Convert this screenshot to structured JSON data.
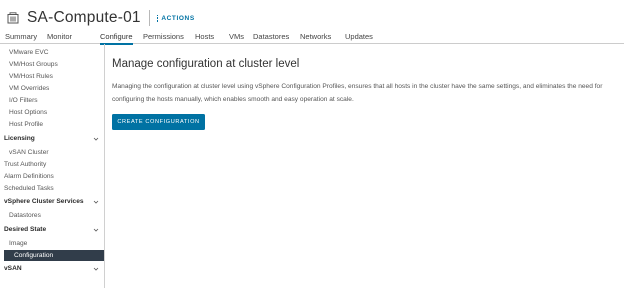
{
  "header": {
    "title": "SA-Compute-01",
    "title_icon": "cluster-icon",
    "actions_label": "ACTIONS"
  },
  "tabs": [
    {
      "label": "Summary",
      "active": false
    },
    {
      "label": "Monitor",
      "active": false
    },
    {
      "label": "Configure",
      "active": true
    },
    {
      "label": "Permissions",
      "active": false
    },
    {
      "label": "Hosts",
      "active": false
    },
    {
      "label": "VMs",
      "active": false
    },
    {
      "label": "Datastores",
      "active": false
    },
    {
      "label": "Networks",
      "active": false
    },
    {
      "label": "Updates",
      "active": false
    }
  ],
  "sidebar": {
    "items": [
      {
        "label": "VMware EVC",
        "kind": "sub"
      },
      {
        "label": "VM/Host Groups",
        "kind": "sub"
      },
      {
        "label": "VM/Host Rules",
        "kind": "sub"
      },
      {
        "label": "VM Overrides",
        "kind": "sub"
      },
      {
        "label": "I/O Filters",
        "kind": "sub"
      },
      {
        "label": "Host Options",
        "kind": "sub"
      },
      {
        "label": "Host Profile",
        "kind": "sub"
      },
      {
        "label": "Licensing",
        "kind": "group",
        "expanded": true
      },
      {
        "label": "vSAN Cluster",
        "kind": "sub"
      },
      {
        "label": "Trust Authority",
        "kind": "top"
      },
      {
        "label": "Alarm Definitions",
        "kind": "top"
      },
      {
        "label": "Scheduled Tasks",
        "kind": "top"
      },
      {
        "label": "vSphere Cluster Services",
        "kind": "group",
        "expanded": true
      },
      {
        "label": "Datastores",
        "kind": "sub"
      },
      {
        "label": "Desired State",
        "kind": "group",
        "expanded": true
      },
      {
        "label": "Image",
        "kind": "sub"
      },
      {
        "label": "Configuration",
        "kind": "sub",
        "selected": true
      },
      {
        "label": "vSAN",
        "kind": "group",
        "expanded": true
      }
    ]
  },
  "main": {
    "heading": "Manage configuration at cluster level",
    "description": "Managing the configuration at cluster level using vSphere Configuration Profiles, ensures that all hosts in the cluster have the same settings, and eliminates the need for configuring the hosts manually, which enables smooth and easy operation at scale.",
    "create_button_label": "CREATE CONFIGURATION"
  },
  "colors": {
    "accent": "#0072a3",
    "selected_nav_bg": "#313d4a",
    "divider": "#cccccc"
  }
}
